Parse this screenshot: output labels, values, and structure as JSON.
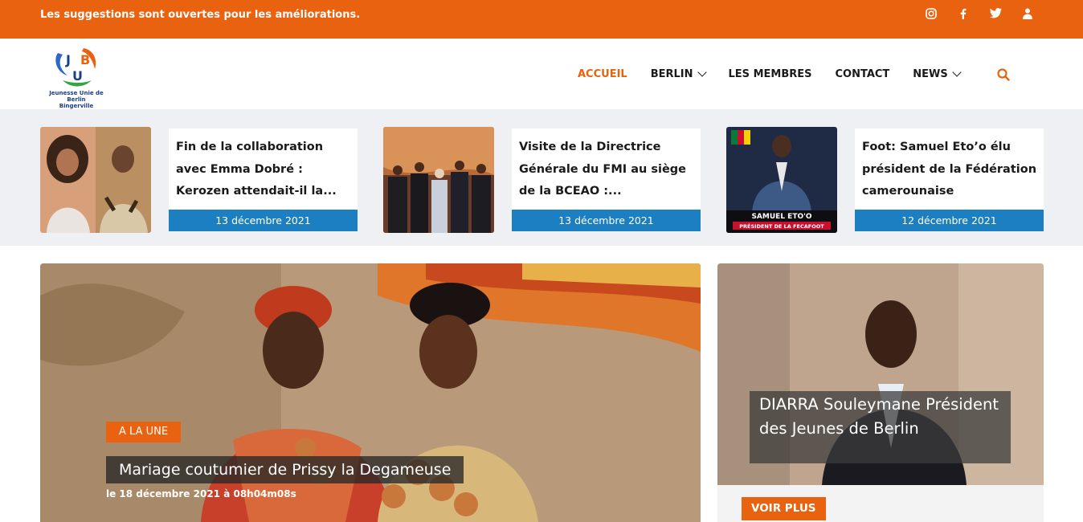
{
  "topbar": {
    "message": "Les suggestions sont ouvertes pour les améliorations.",
    "icons": [
      "instagram-icon",
      "facebook-icon",
      "twitter-icon",
      "user-icon"
    ]
  },
  "logo": {
    "letters": [
      "J",
      "B",
      "U"
    ],
    "caption_line1": "Jeunesse Unie de Berlin",
    "caption_line2": "Bingerville"
  },
  "nav": {
    "items": [
      {
        "label": "ACCUEIL",
        "active": true
      },
      {
        "label": "BERLIN",
        "dropdown": true
      },
      {
        "label": "LES MEMBRES"
      },
      {
        "label": "CONTACT"
      },
      {
        "label": "NEWS",
        "dropdown": true
      }
    ],
    "search_icon": "search-icon"
  },
  "ticker": [
    {
      "title": "Fin de la collaboration avec Emma Dobré : Kerozen attendait-il la...",
      "date": "13 décembre 2021"
    },
    {
      "title": "Visite de la Directrice Générale du FMI au siège de la BCEAO :...",
      "date": "13 décembre 2021"
    },
    {
      "title": "Foot: Samuel Eto’o élu président de la Fédération camerounaise",
      "date": "12 décembre 2021",
      "thumb_caption": "SAMUEL ETO'O",
      "thumb_subcaption": "PRÉSIDENT DE LA FECAFOOT"
    }
  ],
  "feature": {
    "badge": "A LA UNE",
    "title": "Mariage coutumier de Prissy la Degameuse",
    "date": "le 18 décembre 2021 à 08h04m08s"
  },
  "side": {
    "title": "DIARRA Souleymane Président des Jeunes de Berlin",
    "button": "VOIR PLUS"
  },
  "colors": {
    "accent": "#e9620f",
    "date_bar": "#1c7fc2",
    "band_bg": "#eef0f4"
  }
}
